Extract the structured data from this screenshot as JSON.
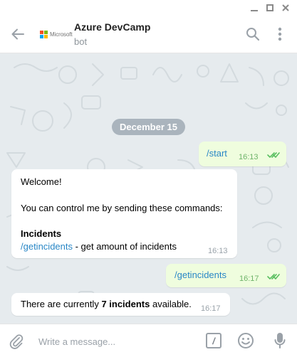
{
  "window": {
    "buttons": [
      "minimize",
      "maximize",
      "close"
    ]
  },
  "header": {
    "logo_text": "Microsoft",
    "title": "Azure DevCamp",
    "subtitle": "bot",
    "icons": [
      "back-arrow-icon",
      "search-icon",
      "more-vertical-icon"
    ]
  },
  "chat": {
    "date_divider": "December 15",
    "messages": [
      {
        "direction": "out",
        "text": "/start",
        "time": "16:13",
        "status": "read"
      },
      {
        "direction": "in",
        "line1": "Welcome!",
        "line2": "You can control me by sending these commands:",
        "heading": "Incidents",
        "command": "/getincidents",
        "command_desc": " - get amount of incidents",
        "time": "16:13"
      },
      {
        "direction": "out",
        "text": "/getincidents",
        "time": "16:17",
        "status": "read"
      },
      {
        "direction": "in",
        "prefix": "There are currently ",
        "bold": "7 incidents",
        "suffix": " available.",
        "time": "16:17"
      }
    ]
  },
  "input": {
    "placeholder": "Write a message...",
    "bot_command_symbol": "/",
    "icons": [
      "paperclip-icon",
      "bot-command-icon",
      "emoji-icon",
      "microphone-icon"
    ]
  },
  "colors": {
    "chat_background": "#e6ebee",
    "outgoing_bubble": "#effdde",
    "incoming_bubble": "#ffffff",
    "link": "#2a87c6",
    "read_check": "#5bbf61",
    "date_pill": "#8a98a6"
  }
}
